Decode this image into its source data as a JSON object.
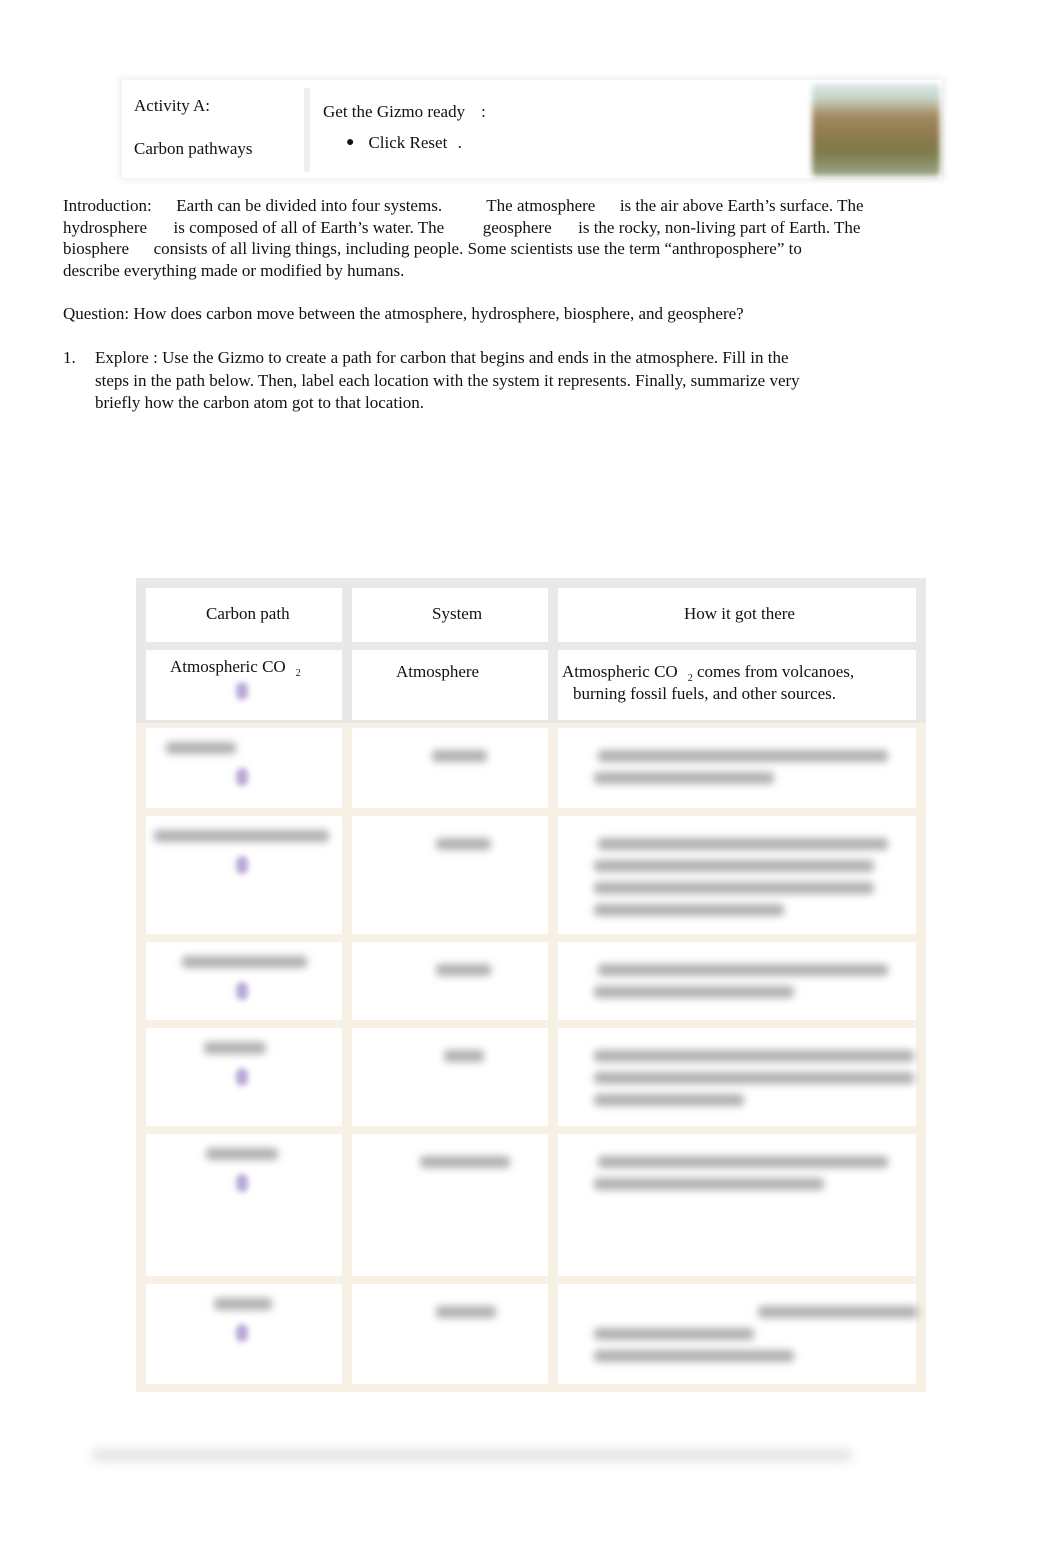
{
  "header": {
    "activity_label": "Activity A:",
    "activity_title": "Carbon pathways",
    "get_ready_label": "Get the Gizmo ready",
    "get_ready_colon": ":",
    "steps": [
      {
        "bullet": "●",
        "text": "Click Reset",
        "end": "."
      }
    ],
    "thumbnail_icon": "gizmo-thumbnail-image"
  },
  "introduction": {
    "label": "Introduction:",
    "s1": "Earth can be divided into four systems.",
    "s2_pre": "The",
    "term_atmosphere": "atmosphere",
    "s2_post": "is the air above Earth’s surface. The",
    "term_hydrosphere": "hydrosphere",
    "s3_post": "is composed of all of Earth’s water. The",
    "term_geosphere": "geosphere",
    "s4_post": "is the rocky, non-living part of Earth. The",
    "term_biosphere": "biosphere",
    "s5_post": "consists of all living things, including people. Some scientists use the term “anthroposphere” to",
    "s6": "describe everything made or modified by humans."
  },
  "question": "Question: How does carbon move between the atmosphere, hydrosphere, biosphere, and geosphere?",
  "item1": {
    "number": "1.",
    "label": "Explore",
    "separator": ":",
    "line1": "Use the Gizmo to create a path for carbon that begins and ends in the atmosphere. Fill in the",
    "line2": "steps in the path below. Then, label each location with the system it represents. Finally, summarize very",
    "line3": "briefly how the carbon atom got to that location."
  },
  "table": {
    "headers": [
      "Carbon path",
      "System",
      "How it got there"
    ],
    "first_row": {
      "carbon_path": "Atmospheric CO",
      "carbon_path_sub": "2",
      "system": "Atmosphere",
      "how_line1_pre": "Atmospheric CO",
      "how_line1_sub": "2",
      "how_line1_post": "comes from volcanoes,",
      "how_line2": "burning fossil fuels, and other sources."
    },
    "blurred_rows_count": 6,
    "arrow_color": "#b9a8d6",
    "border_color": "#f6f1e4"
  }
}
